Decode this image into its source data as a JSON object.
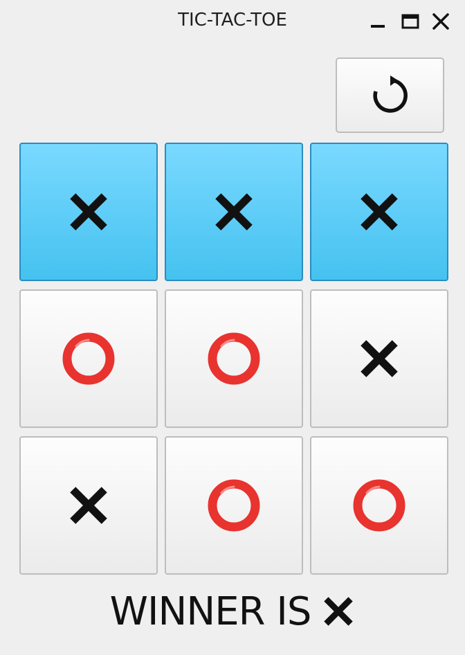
{
  "window": {
    "title": "TIC-TAC-TOE",
    "controls": [
      "minimize-icon",
      "maximize-icon",
      "close-icon"
    ]
  },
  "toolbar": {
    "reset_icon": "restart-icon",
    "reset_glyph": "↻"
  },
  "board": {
    "cells": [
      "X",
      "X",
      "X",
      "O",
      "O",
      "X",
      "X",
      "O",
      "O"
    ],
    "winning_cells": [
      0,
      1,
      2
    ]
  },
  "status": {
    "label": "WINNER IS",
    "winner": "X"
  },
  "colors": {
    "x_mark": "#111111",
    "o_mark": "#e8332f",
    "win_highlight": "#5ccbf5",
    "win_border": "#2a8cc0",
    "cell_border": "#bdbdbd",
    "background": "#efefef"
  }
}
